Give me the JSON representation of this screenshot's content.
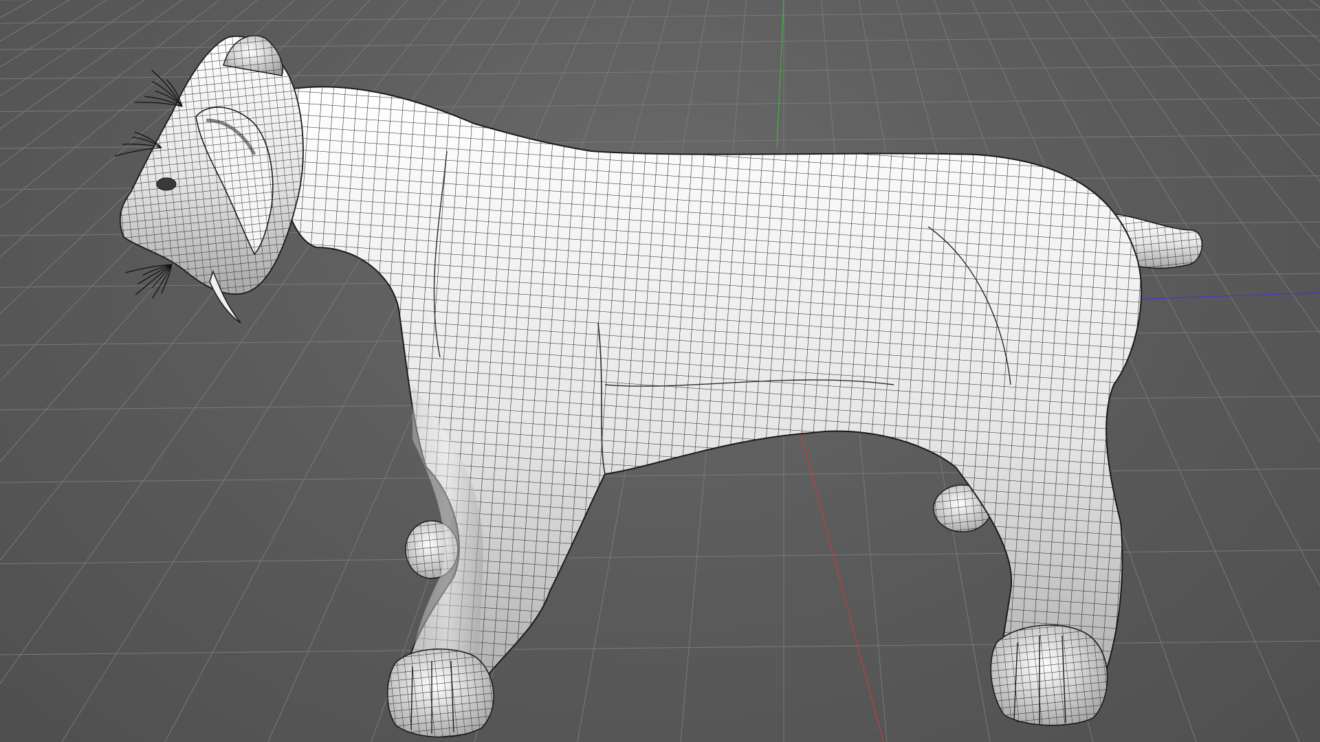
{
  "viewport": {
    "background_color": "#5d5d5d",
    "grid_color": "#7a7a7a",
    "axis_colors": {
      "x": "#3c3cc8",
      "y": "#3cb43c",
      "z": "#c83c3c"
    },
    "shading": "gouraud-with-wireframe-overlay",
    "wireframe_color": "#1a1a1a",
    "surface_color": "#f2f2f2"
  },
  "scene": {
    "object_kind": "saber-toothed-cat-mesh",
    "icons": [
      "grid-floor",
      "world-axis-gizmo",
      "mesh-object"
    ]
  }
}
